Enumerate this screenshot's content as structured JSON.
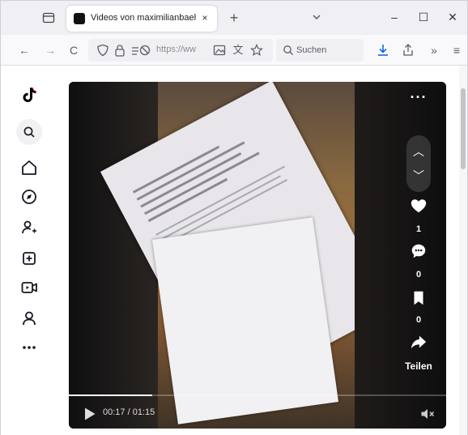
{
  "browser": {
    "tab_title": "Videos von maximilianbaehring",
    "tab_close": "×",
    "new_tab": "+",
    "tab_list": "⌄",
    "window": {
      "minimize": "–",
      "maximize": "☐",
      "close": "✕"
    },
    "back": "←",
    "forward": "→",
    "reload": "C",
    "url": "https://ww",
    "search_placeholder": "Suchen",
    "overflow": "»",
    "menu": "≡"
  },
  "video": {
    "more": "···",
    "nav_up": "︿",
    "nav_down": "﹀",
    "likes": "1",
    "comments": "0",
    "saves": "0",
    "share_label": "Teilen",
    "time": "00:17 / 01:15",
    "progress": 0.22
  },
  "colors": {
    "accent": "#0060df",
    "text": "#1f1f22",
    "video_bg": "#000000"
  }
}
